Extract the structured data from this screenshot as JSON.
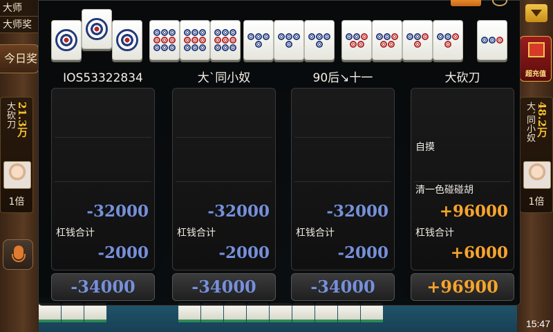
{
  "left_panel": {
    "tabs": [
      "大师",
      "大师奖"
    ],
    "today_button": "今日奖",
    "player": {
      "name": "大砍刀",
      "coins": "21.3万",
      "multiplier": "1倍"
    }
  },
  "right_panel": {
    "gift_label": "超充值",
    "player": {
      "name": "大`同小奴",
      "coins": "48.2万",
      "multiplier": "1倍"
    }
  },
  "clock": "15:47",
  "results": {
    "players": [
      {
        "name": "IOS53322834",
        "hu_types": [],
        "hu_score": "-32000",
        "gang_label": "杠钱合计",
        "gang_score": "-2000",
        "total": "-34000",
        "positive": false
      },
      {
        "name": "大`同小奴",
        "hu_types": [],
        "hu_score": "-32000",
        "gang_label": "杠钱合计",
        "gang_score": "-2000",
        "total": "-34000",
        "positive": false
      },
      {
        "name": "90后↘十一",
        "hu_types": [],
        "hu_score": "-32000",
        "gang_label": "杠钱合计",
        "gang_score": "-2000",
        "total": "-34000",
        "positive": false
      },
      {
        "name": "大砍刀",
        "hu_types": [
          "自摸",
          "清一色碰碰胡"
        ],
        "hu_score": "+96000",
        "gang_label": "杠钱合计",
        "gang_score": "+6000",
        "total": "+96900",
        "positive": true
      }
    ]
  },
  "icons": {
    "mic": "microphone-icon",
    "gift": "gift-box-icon",
    "dropdown": "chevron-down-icon"
  },
  "colors": {
    "negative_score": "#7890d8",
    "positive_score": "#f5a530",
    "coins": "#f4c232"
  }
}
